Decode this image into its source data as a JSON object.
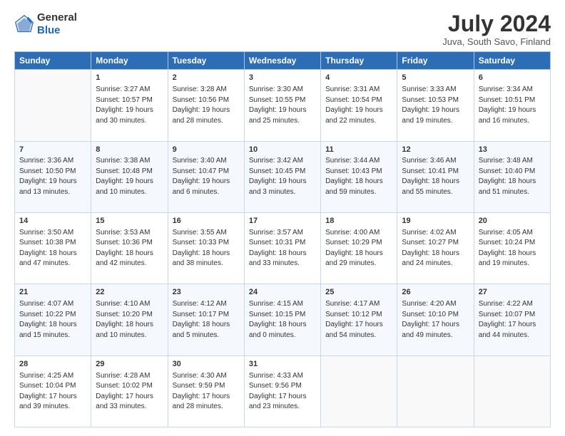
{
  "header": {
    "logo_line1": "General",
    "logo_line2": "Blue",
    "month_title": "July 2024",
    "subtitle": "Juva, South Savo, Finland"
  },
  "days_of_week": [
    "Sunday",
    "Monday",
    "Tuesday",
    "Wednesday",
    "Thursday",
    "Friday",
    "Saturday"
  ],
  "weeks": [
    [
      {
        "day": "",
        "lines": []
      },
      {
        "day": "1",
        "lines": [
          "Sunrise: 3:27 AM",
          "Sunset: 10:57 PM",
          "Daylight: 19 hours",
          "and 30 minutes."
        ]
      },
      {
        "day": "2",
        "lines": [
          "Sunrise: 3:28 AM",
          "Sunset: 10:56 PM",
          "Daylight: 19 hours",
          "and 28 minutes."
        ]
      },
      {
        "day": "3",
        "lines": [
          "Sunrise: 3:30 AM",
          "Sunset: 10:55 PM",
          "Daylight: 19 hours",
          "and 25 minutes."
        ]
      },
      {
        "day": "4",
        "lines": [
          "Sunrise: 3:31 AM",
          "Sunset: 10:54 PM",
          "Daylight: 19 hours",
          "and 22 minutes."
        ]
      },
      {
        "day": "5",
        "lines": [
          "Sunrise: 3:33 AM",
          "Sunset: 10:53 PM",
          "Daylight: 19 hours",
          "and 19 minutes."
        ]
      },
      {
        "day": "6",
        "lines": [
          "Sunrise: 3:34 AM",
          "Sunset: 10:51 PM",
          "Daylight: 19 hours",
          "and 16 minutes."
        ]
      }
    ],
    [
      {
        "day": "7",
        "lines": [
          "Sunrise: 3:36 AM",
          "Sunset: 10:50 PM",
          "Daylight: 19 hours",
          "and 13 minutes."
        ]
      },
      {
        "day": "8",
        "lines": [
          "Sunrise: 3:38 AM",
          "Sunset: 10:48 PM",
          "Daylight: 19 hours",
          "and 10 minutes."
        ]
      },
      {
        "day": "9",
        "lines": [
          "Sunrise: 3:40 AM",
          "Sunset: 10:47 PM",
          "Daylight: 19 hours",
          "and 6 minutes."
        ]
      },
      {
        "day": "10",
        "lines": [
          "Sunrise: 3:42 AM",
          "Sunset: 10:45 PM",
          "Daylight: 19 hours",
          "and 3 minutes."
        ]
      },
      {
        "day": "11",
        "lines": [
          "Sunrise: 3:44 AM",
          "Sunset: 10:43 PM",
          "Daylight: 18 hours",
          "and 59 minutes."
        ]
      },
      {
        "day": "12",
        "lines": [
          "Sunrise: 3:46 AM",
          "Sunset: 10:41 PM",
          "Daylight: 18 hours",
          "and 55 minutes."
        ]
      },
      {
        "day": "13",
        "lines": [
          "Sunrise: 3:48 AM",
          "Sunset: 10:40 PM",
          "Daylight: 18 hours",
          "and 51 minutes."
        ]
      }
    ],
    [
      {
        "day": "14",
        "lines": [
          "Sunrise: 3:50 AM",
          "Sunset: 10:38 PM",
          "Daylight: 18 hours",
          "and 47 minutes."
        ]
      },
      {
        "day": "15",
        "lines": [
          "Sunrise: 3:53 AM",
          "Sunset: 10:36 PM",
          "Daylight: 18 hours",
          "and 42 minutes."
        ]
      },
      {
        "day": "16",
        "lines": [
          "Sunrise: 3:55 AM",
          "Sunset: 10:33 PM",
          "Daylight: 18 hours",
          "and 38 minutes."
        ]
      },
      {
        "day": "17",
        "lines": [
          "Sunrise: 3:57 AM",
          "Sunset: 10:31 PM",
          "Daylight: 18 hours",
          "and 33 minutes."
        ]
      },
      {
        "day": "18",
        "lines": [
          "Sunrise: 4:00 AM",
          "Sunset: 10:29 PM",
          "Daylight: 18 hours",
          "and 29 minutes."
        ]
      },
      {
        "day": "19",
        "lines": [
          "Sunrise: 4:02 AM",
          "Sunset: 10:27 PM",
          "Daylight: 18 hours",
          "and 24 minutes."
        ]
      },
      {
        "day": "20",
        "lines": [
          "Sunrise: 4:05 AM",
          "Sunset: 10:24 PM",
          "Daylight: 18 hours",
          "and 19 minutes."
        ]
      }
    ],
    [
      {
        "day": "21",
        "lines": [
          "Sunrise: 4:07 AM",
          "Sunset: 10:22 PM",
          "Daylight: 18 hours",
          "and 15 minutes."
        ]
      },
      {
        "day": "22",
        "lines": [
          "Sunrise: 4:10 AM",
          "Sunset: 10:20 PM",
          "Daylight: 18 hours",
          "and 10 minutes."
        ]
      },
      {
        "day": "23",
        "lines": [
          "Sunrise: 4:12 AM",
          "Sunset: 10:17 PM",
          "Daylight: 18 hours",
          "and 5 minutes."
        ]
      },
      {
        "day": "24",
        "lines": [
          "Sunrise: 4:15 AM",
          "Sunset: 10:15 PM",
          "Daylight: 18 hours",
          "and 0 minutes."
        ]
      },
      {
        "day": "25",
        "lines": [
          "Sunrise: 4:17 AM",
          "Sunset: 10:12 PM",
          "Daylight: 17 hours",
          "and 54 minutes."
        ]
      },
      {
        "day": "26",
        "lines": [
          "Sunrise: 4:20 AM",
          "Sunset: 10:10 PM",
          "Daylight: 17 hours",
          "and 49 minutes."
        ]
      },
      {
        "day": "27",
        "lines": [
          "Sunrise: 4:22 AM",
          "Sunset: 10:07 PM",
          "Daylight: 17 hours",
          "and 44 minutes."
        ]
      }
    ],
    [
      {
        "day": "28",
        "lines": [
          "Sunrise: 4:25 AM",
          "Sunset: 10:04 PM",
          "Daylight: 17 hours",
          "and 39 minutes."
        ]
      },
      {
        "day": "29",
        "lines": [
          "Sunrise: 4:28 AM",
          "Sunset: 10:02 PM",
          "Daylight: 17 hours",
          "and 33 minutes."
        ]
      },
      {
        "day": "30",
        "lines": [
          "Sunrise: 4:30 AM",
          "Sunset: 9:59 PM",
          "Daylight: 17 hours",
          "and 28 minutes."
        ]
      },
      {
        "day": "31",
        "lines": [
          "Sunrise: 4:33 AM",
          "Sunset: 9:56 PM",
          "Daylight: 17 hours",
          "and 23 minutes."
        ]
      },
      {
        "day": "",
        "lines": []
      },
      {
        "day": "",
        "lines": []
      },
      {
        "day": "",
        "lines": []
      }
    ]
  ]
}
